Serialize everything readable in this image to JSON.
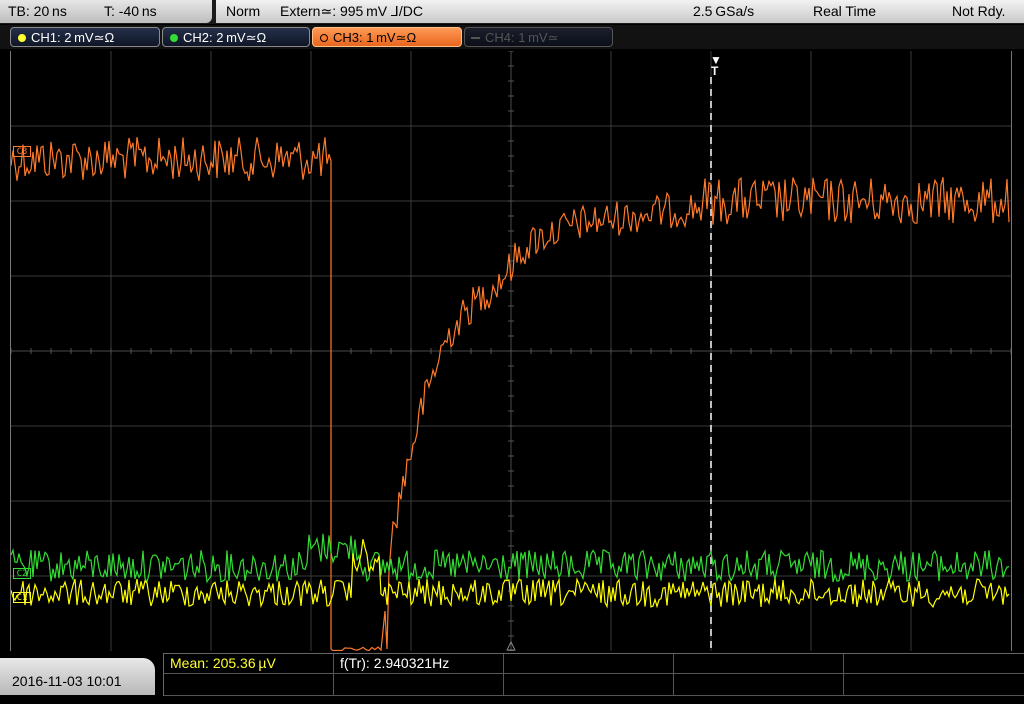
{
  "status": {
    "timebase": "TB: 20 ns",
    "trigger_time": "T: -40 ns",
    "mode": "Norm",
    "trigger": "Extern≃: 995 mV ⅃/DC",
    "sample_rate": "2.5 GSa/s",
    "acq_mode": "Real Time",
    "state": "Not Rdy."
  },
  "channels": [
    {
      "label": "CH1: 2 mV≃Ω",
      "color": "#ffff00",
      "active": false,
      "enabled": true
    },
    {
      "label": "CH2: 2 mV≃Ω",
      "color": "#33dd33",
      "active": false,
      "enabled": true
    },
    {
      "label": "CH3: 1 mV≃Ω",
      "color": "#ff7a2a",
      "active": true,
      "enabled": true
    },
    {
      "label": "CH4: 1 mV≃",
      "color": "#555555",
      "active": false,
      "enabled": false
    }
  ],
  "markers": {
    "ch3": "C3",
    "ch2": "C2",
    "ch1": "C1",
    "trigger": "T"
  },
  "measurements": {
    "mean_label": "Mean: ",
    "mean_value": "205.36 µV",
    "freq_label": "f(Tr): ",
    "freq_value": "2.940321Hz"
  },
  "datetime": "2016-11-03 10:01",
  "colors": {
    "ch1": "#ffff00",
    "ch2": "#33dd33",
    "ch3": "#ff7a2a",
    "grid": "#3a3a3a"
  }
}
